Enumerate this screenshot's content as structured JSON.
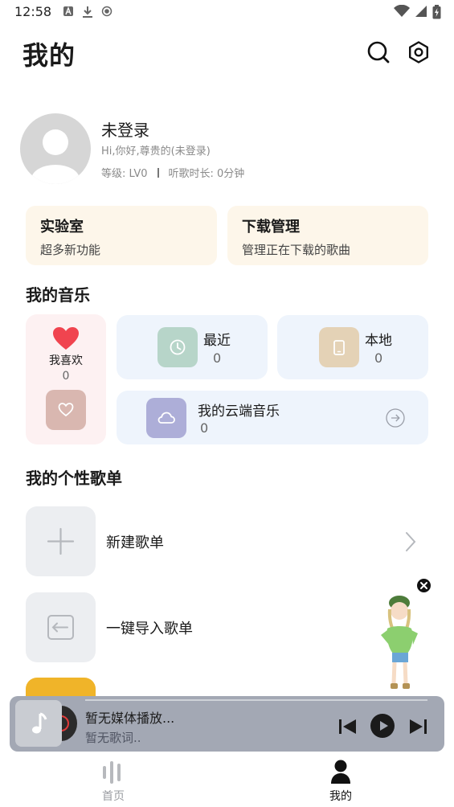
{
  "status_bar": {
    "time": "12:58",
    "left_icons": [
      "a-notification-icon",
      "download-icon",
      "record-icon"
    ],
    "right_icons": [
      "wifi-icon",
      "signal-icon",
      "battery-charging-icon"
    ]
  },
  "header": {
    "title": "我的",
    "icons": [
      "search-icon",
      "settings-icon"
    ]
  },
  "profile": {
    "name": "未登录",
    "greeting": "Hi,你好,尊贵的(未登录)",
    "level": "等级: LV0",
    "listen_time": "听歌时长: 0分钟"
  },
  "features": [
    {
      "title": "实验室",
      "subtitle": "超多新功能"
    },
    {
      "title": "下载管理",
      "subtitle": "管理正在下载的歌曲"
    }
  ],
  "my_music": {
    "section_title": "我的音乐",
    "liked": {
      "label": "我喜欢",
      "count": "0"
    },
    "recent": {
      "label": "最近",
      "count": "0"
    },
    "local": {
      "label": "本地",
      "count": "0"
    },
    "cloud": {
      "label": "我的云端音乐",
      "count": "0"
    }
  },
  "playlists": {
    "section_title": "我的个性歌单",
    "items": [
      {
        "label": "新建歌单"
      },
      {
        "label": "一键导入歌单"
      }
    ]
  },
  "player": {
    "title": "暂无媒体播放...",
    "lyric": "暂无歌词.."
  },
  "bottom_nav": [
    {
      "label": "首页",
      "active": false
    },
    {
      "label": "我的",
      "active": true
    }
  ],
  "colors": {
    "accent_heart": "#f0444f",
    "feature_bg": "#fdf6ea",
    "music_card_bg": "#eef4fc",
    "liked_bg": "#fdf1f2",
    "player_bg": "#a3a8b4"
  }
}
